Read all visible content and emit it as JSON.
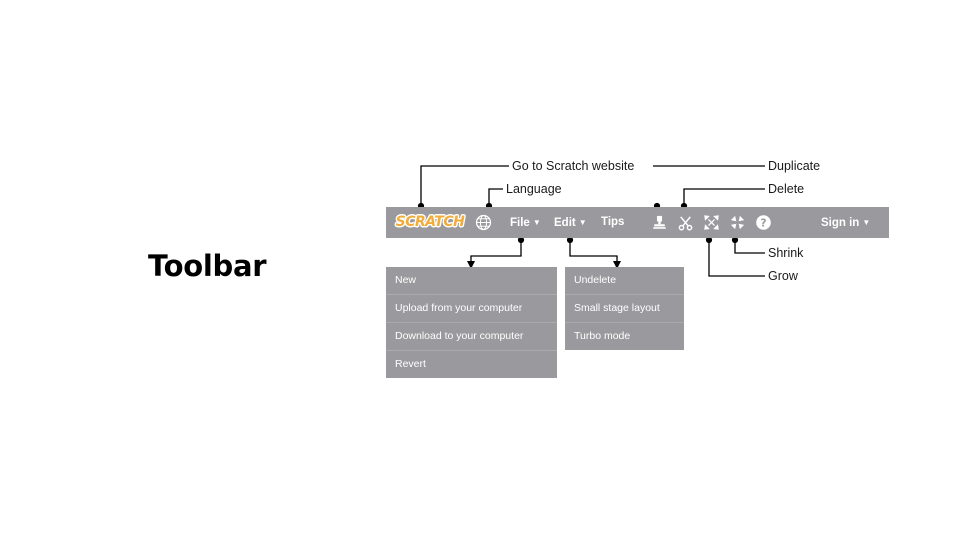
{
  "slide": {
    "title": "Toolbar",
    "background_color": "#ffffff"
  },
  "colors": {
    "toolbar_gray": "#9a9a9e",
    "menu_gray": "#9a9a9e",
    "menu_separator": "#aaaaae",
    "toolbar_text": "#ffffff",
    "logo_orange": "#f2ac3a",
    "logo_outline": "#ffffff",
    "annotation_text": "#1a1a1a",
    "leader_line": "#000000"
  },
  "toolbar": {
    "logo": {
      "text": "SCRATCH",
      "icon": "scratch-logo"
    },
    "items": [
      {
        "id": "language",
        "label": "",
        "icon": "globe-icon",
        "caret": false
      },
      {
        "id": "file",
        "label": "File",
        "icon": null,
        "caret": true
      },
      {
        "id": "edit",
        "label": "Edit",
        "icon": null,
        "caret": true
      },
      {
        "id": "tips",
        "label": "Tips",
        "icon": null,
        "caret": false
      }
    ],
    "icons": [
      {
        "id": "duplicate",
        "icon": "stamp-icon"
      },
      {
        "id": "delete",
        "icon": "scissors-icon"
      },
      {
        "id": "grow",
        "icon": "grow-arrows-icon"
      },
      {
        "id": "shrink",
        "icon": "shrink-arrows-icon"
      },
      {
        "id": "help",
        "icon": "question-mark-icon"
      }
    ],
    "account": {
      "label": "Sign in",
      "caret": true
    },
    "caret_glyph": "▼"
  },
  "menus": {
    "file": {
      "name": "File",
      "items": [
        "New",
        "Upload from your computer",
        "Download to your computer",
        "Revert"
      ]
    },
    "edit": {
      "name": "Edit",
      "items": [
        "Undelete",
        "Small stage layout",
        "Turbo mode"
      ]
    }
  },
  "annotations": [
    {
      "id": "website",
      "label": "Go to Scratch website",
      "target": "scratch-logo"
    },
    {
      "id": "language",
      "label": "Language",
      "target": "globe-icon"
    },
    {
      "id": "duplicate",
      "label": "Duplicate",
      "target": "stamp-icon"
    },
    {
      "id": "delete",
      "label": "Delete",
      "target": "scissors-icon"
    },
    {
      "id": "shrink",
      "label": "Shrink",
      "target": "shrink-arrows-icon"
    },
    {
      "id": "grow",
      "label": "Grow",
      "target": "grow-arrows-icon"
    }
  ]
}
